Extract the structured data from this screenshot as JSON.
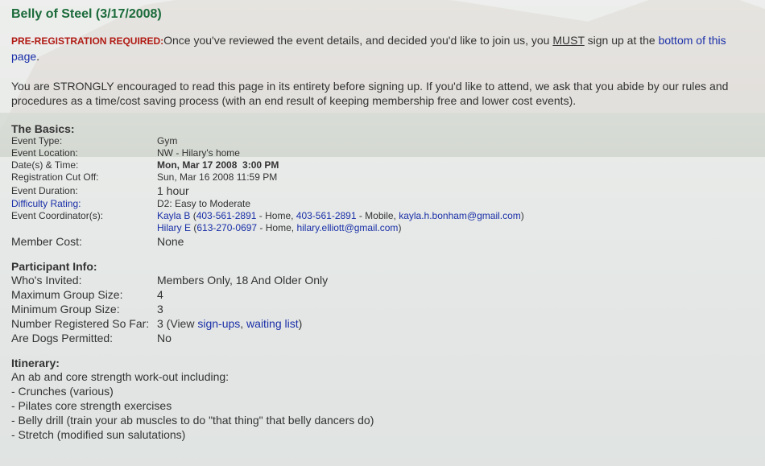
{
  "title": "Belly of Steel (3/17/2008)",
  "notice": {
    "warn": "PRE-REGISTRATION REQUIRED:",
    "text_a": "Once you've reviewed the event details, and decided you'd like to join us, you ",
    "must": "MUST",
    "text_b": " sign up at the ",
    "link": "bottom of this page",
    "text_c": "."
  },
  "encourage_text": "You are STRONGLY encouraged to read this page in its entirety before signing up. If you'd like to attend, we ask that you abide by our rules and procedures as a time/cost saving process (with an end result of keeping membership free and lower cost events).",
  "basics": {
    "title": "The Basics:",
    "event_type_label": "Event Type:",
    "event_type": "Gym",
    "location_label": "Event Location:",
    "location": "NW - Hilary's home",
    "datetime_label": "Date(s) & Time:",
    "datetime": "Mon, Mar 17 2008  3:00 PM",
    "cutoff_label": "Registration Cut Off:",
    "cutoff": "Sun, Mar 16 2008 11:59 PM",
    "duration_label": "Event Duration:",
    "duration": "1 hour",
    "difficulty_label": "Difficulty Rating:",
    "difficulty": "D2: Easy to Moderate",
    "coordinators_label": "Event Coordinator(s):",
    "coord1": {
      "name": "Kayla B",
      "phone_home": "403-561-2891",
      "home_text": " - Home, ",
      "phone_mobile": "403-561-2891",
      "mobile_text": " - Mobile, ",
      "email": "kayla.h.bonham@gmail.com"
    },
    "coord2": {
      "name": "Hilary E",
      "phone_home": "613-270-0697",
      "home_text": " - Home, ",
      "email": "hilary.elliott@gmail.com"
    },
    "cost_label": "Member Cost:",
    "cost": "None"
  },
  "participants": {
    "title": "Participant Info:",
    "invited_label": "Who's Invited:",
    "invited": "Members Only, 18 And Older Only",
    "max_label": "Maximum Group Size:",
    "max": "4",
    "min_label": "Minimum Group Size:",
    "min": "3",
    "registered_label": "Number Registered So Far:",
    "registered_count": "3",
    "view_text": "View ",
    "signups_link": "sign-ups",
    "waiting_link": "waiting list",
    "dogs_label": "Are Dogs Permitted:",
    "dogs": "No"
  },
  "itinerary": {
    "title": "Itinerary:",
    "lines": [
      "An ab and core strength work-out including:",
      "- Crunches (various)",
      "- Pilates core strength exercises",
      "- Belly drill (train your ab muscles to do \"that thing\" that belly dancers do)",
      "- Stretch (modified sun salutations)"
    ]
  }
}
